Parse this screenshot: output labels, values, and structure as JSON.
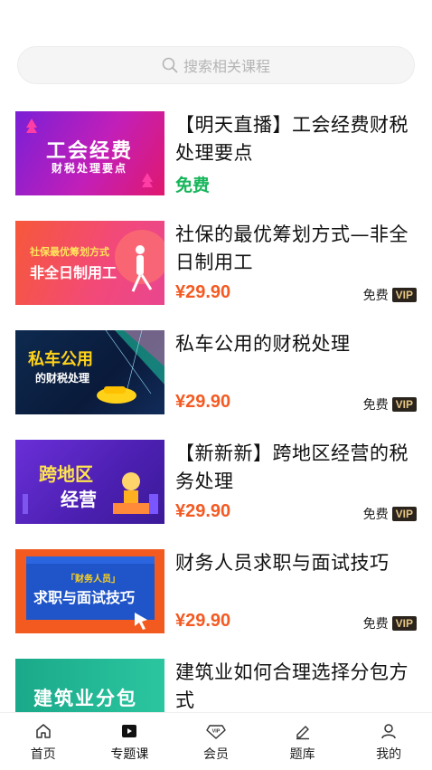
{
  "search": {
    "placeholder": "搜索相关课程",
    "icon": "search-icon"
  },
  "courses": [
    {
      "thumb_lines": [
        "工会经费",
        "财税处理要点"
      ],
      "title": "【明天直播】工会经费财税处理要点",
      "price": "免费",
      "is_free": true
    },
    {
      "thumb_lines": [
        "社保最优筹划方式",
        "非全日制用工"
      ],
      "title": "社保的最优筹划方式—非全日制用工",
      "price": "¥29.90",
      "vip_free_label": "免费",
      "vip_label": "VIP"
    },
    {
      "thumb_lines": [
        "私车公用",
        "的财税处理"
      ],
      "title": "私车公用的财税处理",
      "price": "¥29.90",
      "vip_free_label": "免费",
      "vip_label": "VIP"
    },
    {
      "thumb_lines": [
        "跨地区",
        "经营"
      ],
      "title": "【新新新】跨地区经营的税务处理",
      "price": "¥29.90",
      "vip_free_label": "免费",
      "vip_label": "VIP"
    },
    {
      "thumb_lines": [
        "「财务人员」",
        "求职与面试技巧"
      ],
      "title": "财务人员求职与面试技巧",
      "price": "¥29.90",
      "vip_free_label": "免费",
      "vip_label": "VIP"
    },
    {
      "thumb_lines": [
        "建筑业分包"
      ],
      "title": "建筑业如何合理选择分包方式"
    }
  ],
  "tabbar": [
    {
      "label": "首页",
      "icon": "home-icon"
    },
    {
      "label": "专题课",
      "icon": "play-icon",
      "active": true
    },
    {
      "label": "会员",
      "icon": "vip-diamond-icon"
    },
    {
      "label": "题库",
      "icon": "pencil-icon"
    },
    {
      "label": "我的",
      "icon": "user-icon"
    }
  ],
  "colors": {
    "price": "#f45a22",
    "free": "#16b55a",
    "vip_bg": "#2a241d",
    "vip_text": "#e8c786"
  }
}
